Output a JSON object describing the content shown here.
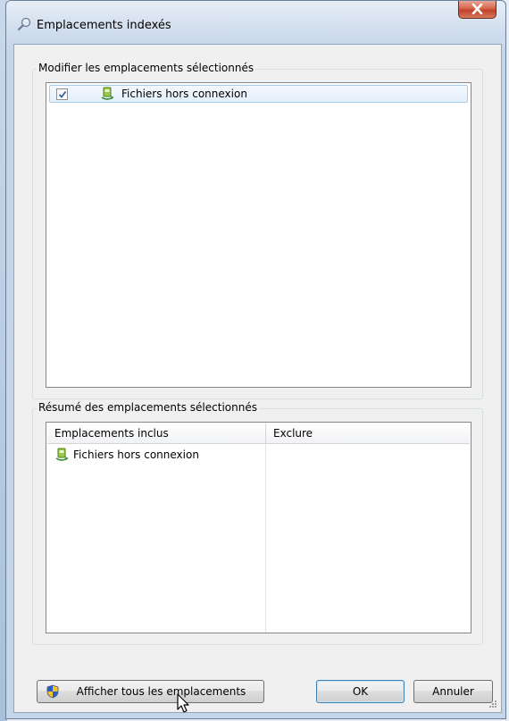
{
  "window": {
    "title": "Emplacements indexés",
    "close_label": "X"
  },
  "modify_group": {
    "label": "Modifier les emplacements sélectionnés",
    "items": [
      {
        "label": "Fichiers hors connexion",
        "checked": true,
        "icon": "offline-files-icon"
      }
    ]
  },
  "summary_group": {
    "label": "Résumé des emplacements sélectionnés",
    "columns": [
      "Emplacements inclus",
      "Exclure"
    ],
    "included": [
      {
        "label": "Fichiers hors connexion",
        "icon": "offline-files-icon"
      }
    ],
    "excluded": []
  },
  "buttons": {
    "show_all": "Afficher tous les emplacements",
    "ok": "OK",
    "cancel": "Annuler"
  },
  "colors": {
    "title_bar": "#cfdcec",
    "close_button": "#c2402a",
    "selection": "#e3effc",
    "default_button_border": "#3c7fb1"
  }
}
